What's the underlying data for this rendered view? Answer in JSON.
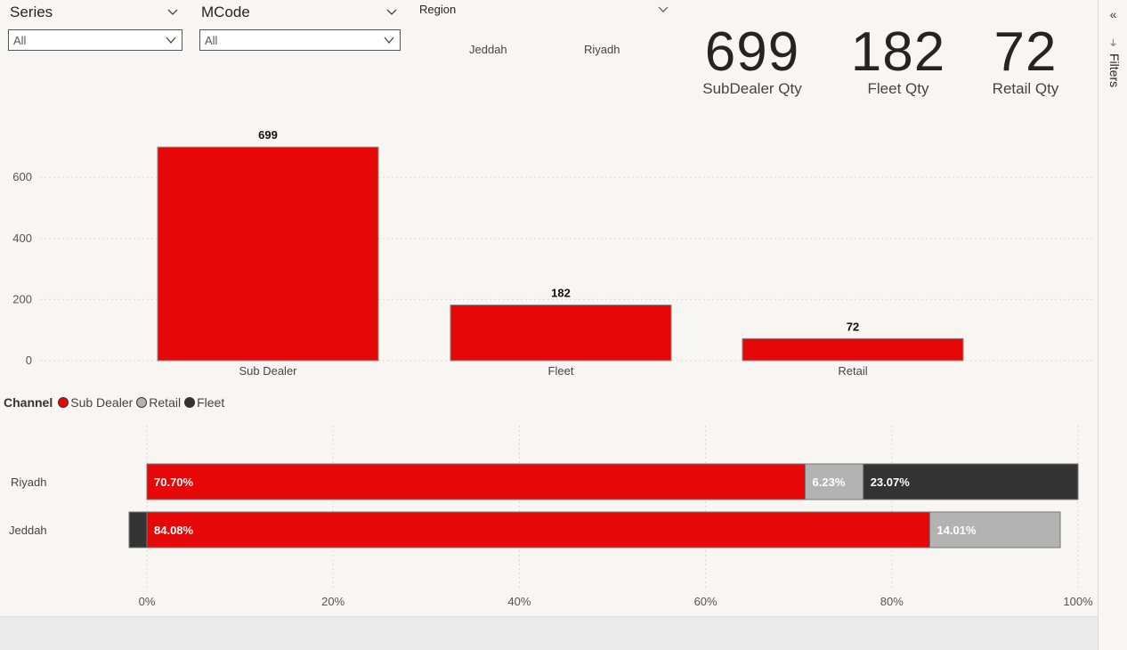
{
  "slicers": {
    "series": {
      "title": "Series",
      "value": "All"
    },
    "mcode": {
      "title": "MCode",
      "value": "All"
    },
    "region": {
      "title": "Region",
      "options": [
        "Jeddah",
        "Riyadh"
      ]
    }
  },
  "cards": [
    {
      "value": "699",
      "label": "SubDealer Qty"
    },
    {
      "value": "182",
      "label": "Fleet Qty"
    },
    {
      "value": "72",
      "label": "Retail Qty"
    }
  ],
  "filters_pane": {
    "label": "Filters"
  },
  "colors": {
    "sub_dealer": "#e60808",
    "retail": "#b3b3b3",
    "fleet": "#333333",
    "bg": "#f7f6f2"
  },
  "chart_data": [
    {
      "type": "bar",
      "categories": [
        "Sub Dealer",
        "Fleet",
        "Retail"
      ],
      "values": [
        699,
        182,
        72
      ],
      "data_labels": [
        "699",
        "182",
        "72"
      ],
      "yticks": [
        0,
        200,
        400,
        600
      ],
      "ylim": [
        0,
        720
      ],
      "grid": true
    },
    {
      "type": "bar",
      "orientation": "horizontal-stacked-100",
      "legend_title": "Channel",
      "legend": [
        "Sub Dealer",
        "Retail",
        "Fleet"
      ],
      "categories": [
        "Riyadh",
        "Jeddah"
      ],
      "series": [
        {
          "name": "Sub Dealer",
          "values": [
            70.7,
            84.08
          ],
          "labels": [
            "70.70%",
            "84.08%"
          ]
        },
        {
          "name": "Retail",
          "values": [
            6.23,
            14.01
          ],
          "labels": [
            "6.23%",
            "14.01%"
          ]
        },
        {
          "name": "Fleet",
          "values": [
            23.07,
            1.91
          ],
          "labels": [
            "23.07%",
            ""
          ]
        }
      ],
      "xticks": [
        "0%",
        "20%",
        "40%",
        "60%",
        "80%",
        "100%"
      ],
      "xlim": [
        0,
        100
      ],
      "grid": true
    }
  ]
}
